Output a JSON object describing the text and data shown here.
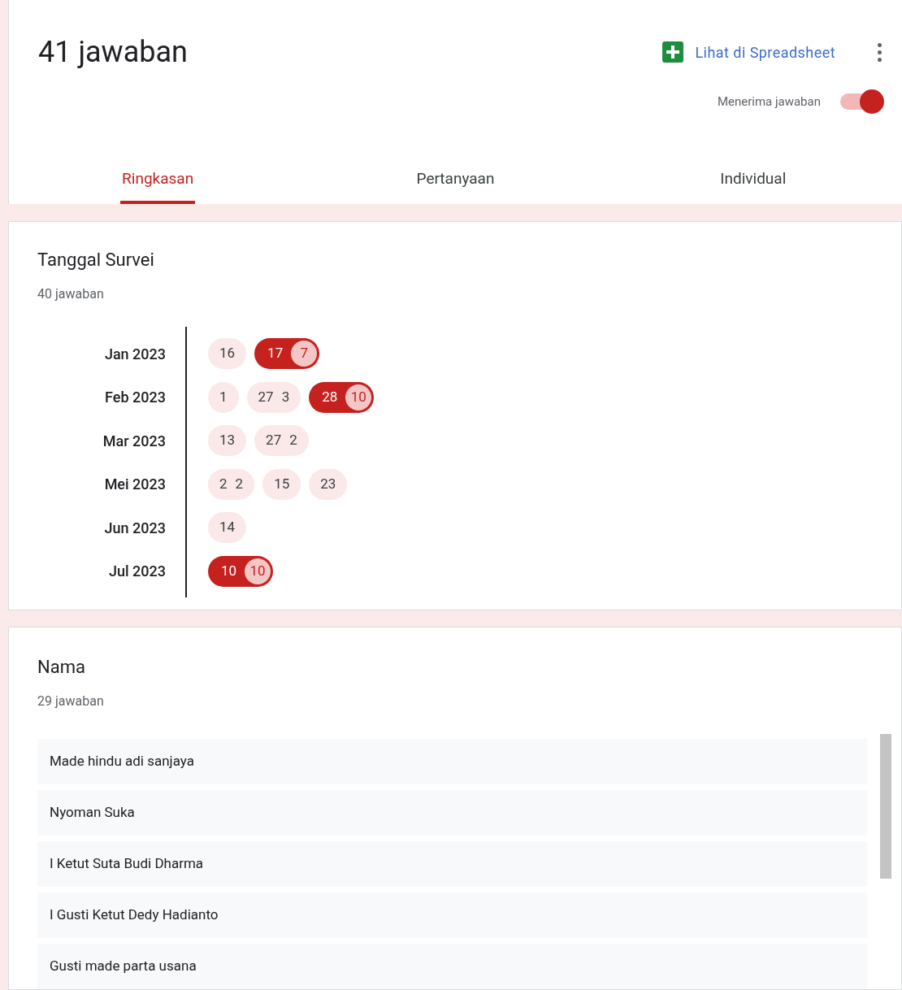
{
  "header": {
    "title": "41 jawaban",
    "sheet_link": "Lihat di Spreadsheet",
    "accepting_label": "Menerima jawaban",
    "accepting_on": true
  },
  "tabs": [
    {
      "label": "Ringkasan",
      "selected": true
    },
    {
      "label": "Pertanyaan",
      "selected": false
    },
    {
      "label": "Individual",
      "selected": false
    }
  ],
  "date_question": {
    "title": "Tanggal Survei",
    "count": "40 jawaban",
    "months": [
      {
        "label": "Jan 2023",
        "days": [
          {
            "day": "16",
            "emphasized": false
          },
          {
            "day": "17",
            "count": "7",
            "emphasized": true
          }
        ]
      },
      {
        "label": "Feb 2023",
        "days": [
          {
            "day": "1",
            "emphasized": false
          },
          {
            "day": "27",
            "count": "3",
            "emphasized": false
          },
          {
            "day": "28",
            "count": "10",
            "emphasized": true
          }
        ]
      },
      {
        "label": "Mar 2023",
        "days": [
          {
            "day": "13",
            "emphasized": false
          },
          {
            "day": "27",
            "count": "2",
            "emphasized": false
          }
        ]
      },
      {
        "label": "Mei 2023",
        "days": [
          {
            "day": "2",
            "count": "2",
            "emphasized": false
          },
          {
            "day": "15",
            "emphasized": false
          },
          {
            "day": "23",
            "emphasized": false
          }
        ]
      },
      {
        "label": "Jun 2023",
        "days": [
          {
            "day": "14",
            "emphasized": false
          }
        ]
      },
      {
        "label": "Jul 2023",
        "days": [
          {
            "day": "10",
            "count": "10",
            "emphasized": true
          }
        ]
      }
    ]
  },
  "name_question": {
    "title": "Nama",
    "count": "29 jawaban",
    "answers": [
      "Made hindu adi sanjaya",
      "Nyoman Suka",
      "I Ketut Suta Budi Dharma",
      "I Gusti Ketut Dedy Hadianto",
      "Gusti made parta usana"
    ]
  }
}
